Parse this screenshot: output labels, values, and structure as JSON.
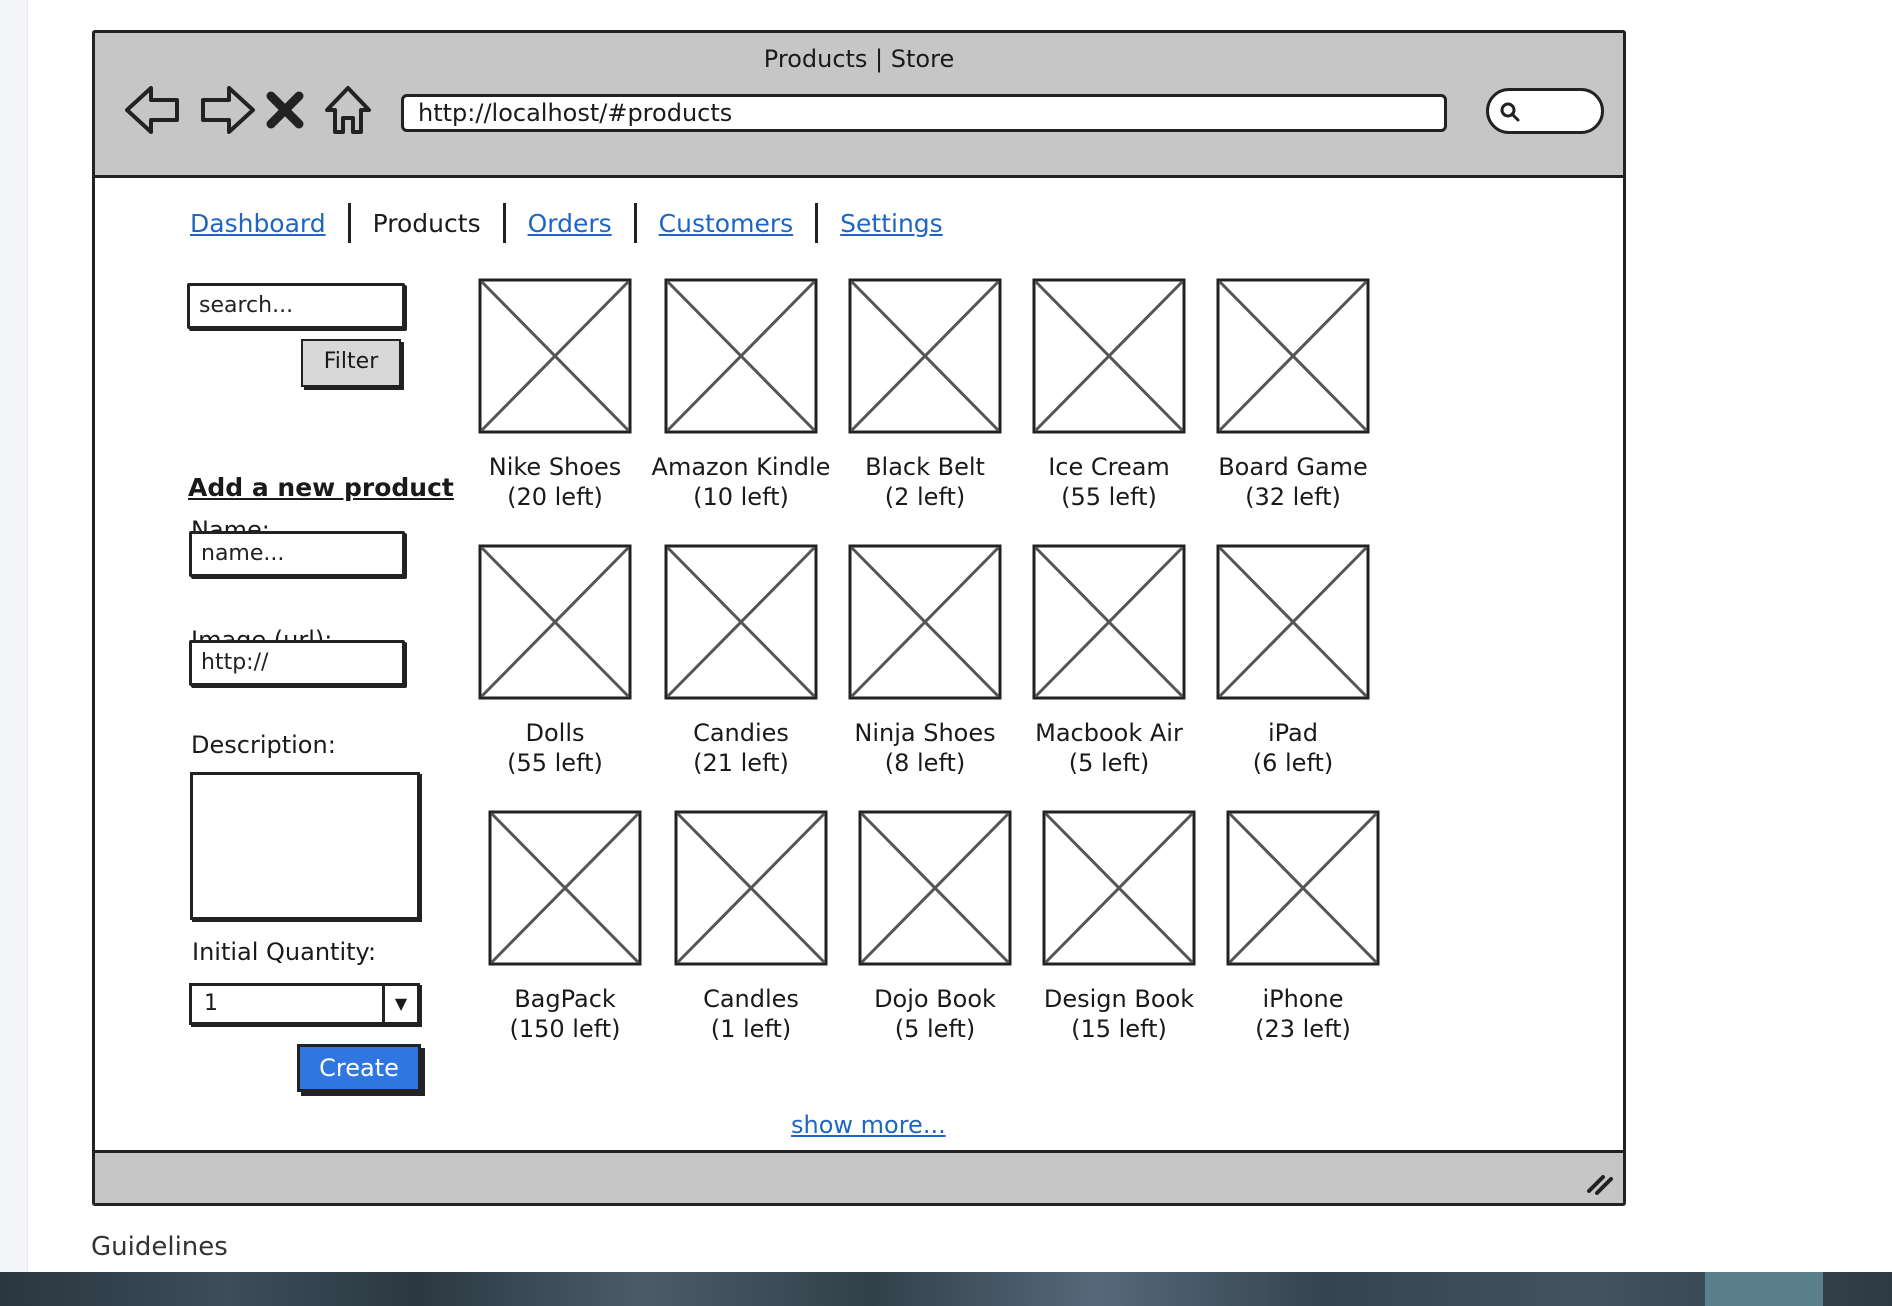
{
  "window": {
    "title": "Products | Store"
  },
  "address_bar": {
    "url": "http://localhost/#products"
  },
  "nav": {
    "items": [
      {
        "label": "Dashboard",
        "current": false
      },
      {
        "label": "Products",
        "current": true
      },
      {
        "label": "Orders",
        "current": false
      },
      {
        "label": "Customers",
        "current": false
      },
      {
        "label": "Settings",
        "current": false
      }
    ]
  },
  "filter": {
    "search_placeholder": "search...",
    "button_label": "Filter"
  },
  "new_product_form": {
    "title": "Add a new product",
    "name_label": "Name:",
    "name_placeholder": "name...",
    "image_label": "Image (url):",
    "image_value": "http://",
    "description_label": "Description:",
    "quantity_label": "Initial Quantity:",
    "quantity_value": "1",
    "create_label": "Create"
  },
  "products": [
    {
      "name": "Nike Shoes",
      "stock": "(20 left)"
    },
    {
      "name": "Amazon Kindle",
      "stock": "(10 left)"
    },
    {
      "name": "Black Belt",
      "stock": "(2 left)"
    },
    {
      "name": "Ice Cream",
      "stock": "(55 left)"
    },
    {
      "name": "Board Game",
      "stock": "(32 left)"
    },
    {
      "name": "Dolls",
      "stock": "(55 left)"
    },
    {
      "name": "Candies",
      "stock": "(21 left)"
    },
    {
      "name": "Ninja Shoes",
      "stock": "(8 left)"
    },
    {
      "name": "Macbook Air",
      "stock": "(5 left)"
    },
    {
      "name": "iPad",
      "stock": "(6 left)"
    },
    {
      "name": "BagPack",
      "stock": "(150 left)"
    },
    {
      "name": "Candles",
      "stock": "(1 left)"
    },
    {
      "name": "Dojo Book",
      "stock": "(5 left)"
    },
    {
      "name": "Design Book",
      "stock": "(15 left)"
    },
    {
      "name": "iPhone",
      "stock": "(23 left)"
    }
  ],
  "show_more_label": "show more...",
  "page_caption": "Guidelines",
  "colors": {
    "link": "#1f66c2",
    "create_button": "#2f76e0",
    "chrome": "#c6c6c6"
  }
}
